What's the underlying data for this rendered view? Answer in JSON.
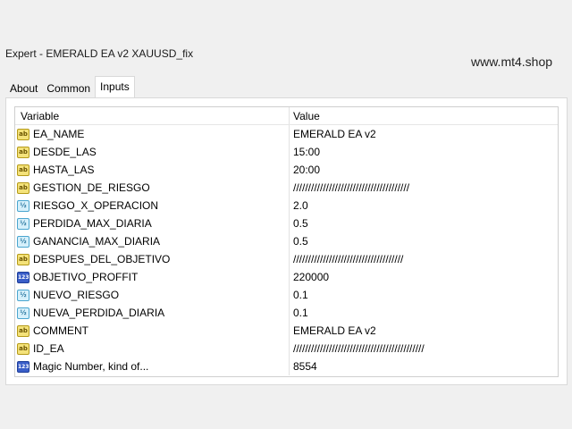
{
  "window": {
    "title": "Expert - EMERALD EA v2 XAUUSD_fix",
    "watermark": "www.mt4.shop"
  },
  "tabs": [
    {
      "label": "About",
      "active": false
    },
    {
      "label": "Common",
      "active": false
    },
    {
      "label": "Inputs",
      "active": true
    }
  ],
  "grid": {
    "columns": {
      "variable": "Variable",
      "value": "Value"
    },
    "rows": [
      {
        "icon": "ab",
        "name": "EA_NAME",
        "value": "EMERALD EA v2"
      },
      {
        "icon": "ab",
        "name": "DESDE_LAS",
        "value": "15:00"
      },
      {
        "icon": "ab",
        "name": "HASTA_LAS",
        "value": "20:00"
      },
      {
        "icon": "ab",
        "name": "GESTION_DE_RIESGO",
        "value": "///////////////////////////////////////"
      },
      {
        "icon": "v2",
        "name": "RIESGO_X_OPERACION",
        "value": "2.0"
      },
      {
        "icon": "v2",
        "name": "PERDIDA_MAX_DIARIA",
        "value": "0.5"
      },
      {
        "icon": "v2",
        "name": "GANANCIA_MAX_DIARIA",
        "value": "0.5"
      },
      {
        "icon": "ab",
        "name": "DESPUES_DEL_OBJETIVO",
        "value": "/////////////////////////////////////"
      },
      {
        "icon": "123",
        "name": "OBJETIVO_PROFFIT",
        "value": "220000"
      },
      {
        "icon": "v2",
        "name": "NUEVO_RIESGO",
        "value": "0.1"
      },
      {
        "icon": "v2",
        "name": "NUEVA_PERDIDA_DIARIA",
        "value": "0.1"
      },
      {
        "icon": "ab",
        "name": "COMMENT",
        "value": "EMERALD EA v2"
      },
      {
        "icon": "ab",
        "name": "ID_EA",
        "value": "////////////////////////////////////////////"
      },
      {
        "icon": "123",
        "name": "Magic Number, kind of...",
        "value": "8554"
      }
    ]
  },
  "icon_names": {
    "ab": "string-type-icon",
    "v2": "double-type-icon",
    "123": "integer-type-icon"
  },
  "colors": {
    "panel_bg": "#ffffff",
    "window_bg": "#f0f0f0",
    "string_icon": "#f4e27a",
    "double_icon": "#d6f0fb",
    "integer_icon": "#3a5ec8"
  }
}
